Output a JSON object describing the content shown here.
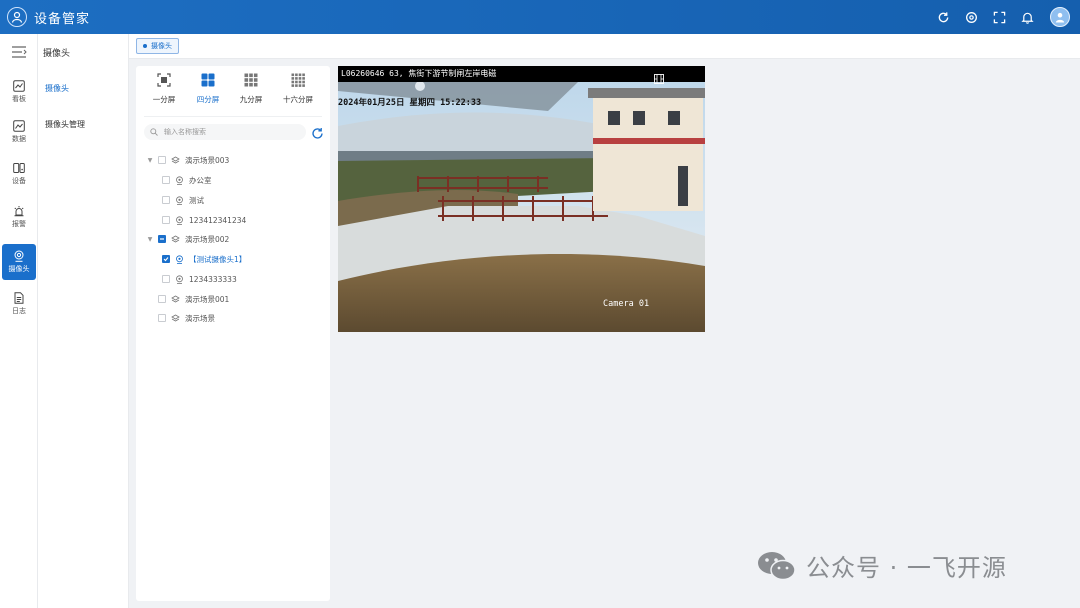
{
  "app": {
    "title": "设备管家"
  },
  "header": {
    "tools": [
      "refresh-icon",
      "settings-icon",
      "fullscreen-icon",
      "bell-icon",
      "user-avatar"
    ]
  },
  "rail": {
    "items": [
      {
        "icon": "chart-line-icon",
        "label": "看板"
      },
      {
        "icon": "data-chart-icon",
        "label": "数据"
      },
      {
        "icon": "device-icon",
        "label": "设备"
      },
      {
        "icon": "alarm-icon",
        "label": "报警"
      },
      {
        "icon": "camera-icon",
        "label": "摄像头",
        "active": true
      },
      {
        "icon": "log-icon",
        "label": "日志"
      }
    ]
  },
  "submenu": {
    "title": "摄像头",
    "items": [
      {
        "label": "摄像头",
        "active": true
      },
      {
        "label": "摄像头管理"
      }
    ]
  },
  "tabs": [
    {
      "label": "摄像头",
      "active": true
    }
  ],
  "layouts": [
    {
      "label": "一分屏",
      "icon": "single-screen-icon"
    },
    {
      "label": "四分屏",
      "icon": "four-screen-icon",
      "active": true
    },
    {
      "label": "九分屏",
      "icon": "nine-screen-icon"
    },
    {
      "label": "十六分屏",
      "icon": "sixteen-screen-icon"
    }
  ],
  "search": {
    "placeholder": "输入名称搜索"
  },
  "tree": [
    {
      "label": "演示场景003",
      "type": "scene",
      "expanded": true,
      "checked": false
    },
    {
      "label": "办公室",
      "type": "camera",
      "checked": false
    },
    {
      "label": "测试",
      "type": "camera",
      "checked": false
    },
    {
      "label": "123412341234",
      "type": "camera",
      "checked": false
    },
    {
      "label": "演示场景002",
      "type": "scene",
      "expanded": true,
      "checked": "partial"
    },
    {
      "label": "【测试摄像头1】",
      "type": "camera",
      "checked": true,
      "active": true
    },
    {
      "label": "1234333333",
      "type": "camera",
      "checked": false
    },
    {
      "label": "演示场景001",
      "type": "scene",
      "checked": false
    },
    {
      "label": "演示场景",
      "type": "scene",
      "checked": false
    }
  ],
  "video": {
    "title": "L06260646 63, 焦街下游节制闸左岸电磁",
    "timestamp": "2024年01月25日 星期四 15:22:33",
    "camera_label": "Camera 01"
  },
  "watermark": {
    "text": "公众号 · 一飞开源",
    "icon": "wechat-icon"
  },
  "colors": {
    "primary": "#1a6fcb",
    "header": "#1d6ec2",
    "background": "#f0f2f5"
  }
}
